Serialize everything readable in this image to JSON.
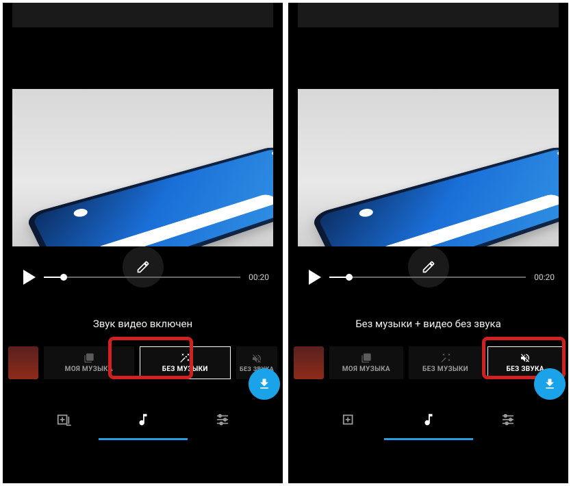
{
  "left": {
    "duration": "00:20",
    "progress_pct": 10,
    "caption": "Звук видео включен",
    "options": {
      "my_music": "МОЯ МУЗЫКА",
      "no_music": "БЕЗ МУЗЫКИ",
      "no_sound": "БЕЗ ЗВУКА"
    },
    "active_option": "no_music",
    "highlight": "no_music"
  },
  "right": {
    "duration": "00:20",
    "progress_pct": 10,
    "caption": "Без музыки + видео без звука",
    "options": {
      "my_music": "МОЯ МУЗЫКА",
      "no_music": "БЕЗ МУЗЫКИ",
      "no_sound": "БЕЗ ЗВУКА"
    },
    "active_option": "no_sound",
    "highlight": "no_sound"
  },
  "icons": {
    "edit": "edit-icon",
    "play": "play-icon",
    "library": "library-icon",
    "wand": "wand-icon",
    "mute": "mute-icon",
    "download": "download-icon",
    "add_clip": "add-clip-icon",
    "music_note": "music-note-icon",
    "sliders": "sliders-icon"
  },
  "colors": {
    "accent": "#1aa3e8",
    "highlight": "#d32020"
  }
}
